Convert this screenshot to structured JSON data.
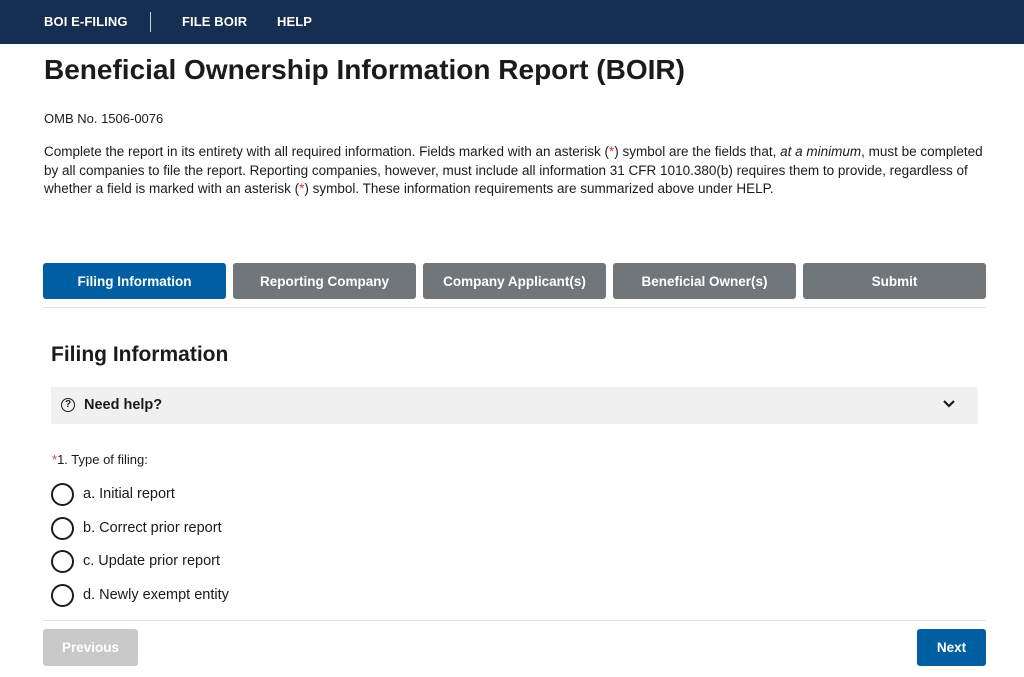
{
  "nav": {
    "brand": "BOI E-FILING",
    "links": [
      "FILE BOIR",
      "HELP"
    ]
  },
  "page": {
    "title": "Beneficial Ownership Information Report (BOIR)",
    "omb": "OMB No. 1506-0076",
    "intro": {
      "part1": "Complete the report in its entirety with all required information. Fields marked with an asterisk (",
      "star": "*",
      "part2": ") symbol are the fields that, ",
      "emphasis": "at a minimum",
      "part3": ", must be completed by all companies to file the report. Reporting companies, however, must include all information 31 CFR 1010.380(b) requires them to provide, regardless of whether a field is marked with an asterisk (",
      "part4": ") symbol. These information requirements are summarized above under HELP."
    }
  },
  "steps": [
    {
      "label": "Filing Information",
      "active": true
    },
    {
      "label": "Reporting Company",
      "active": false
    },
    {
      "label": "Company Applicant(s)",
      "active": false
    },
    {
      "label": "Beneficial Owner(s)",
      "active": false
    },
    {
      "label": "Submit",
      "active": false
    }
  ],
  "section": {
    "title": "Filing Information",
    "help_label": "Need help?",
    "help_icon": "question-circle-icon",
    "expand_icon": "chevron-down-icon"
  },
  "question": {
    "required_mark": "*",
    "label": "1. Type of filing:",
    "options": [
      {
        "label": "a. Initial report",
        "selected": false
      },
      {
        "label": "b. Correct prior report",
        "selected": false
      },
      {
        "label": "c. Update prior report",
        "selected": false
      },
      {
        "label": "d. Newly exempt entity",
        "selected": false
      }
    ]
  },
  "footer": {
    "previous_label": "Previous",
    "previous_enabled": false,
    "next_label": "Next"
  },
  "colors": {
    "nav_bg": "#162e51",
    "primary": "#005ea2",
    "step_inactive": "#71767a",
    "required": "#d83933",
    "disabled_button": "#c9c9c9"
  }
}
